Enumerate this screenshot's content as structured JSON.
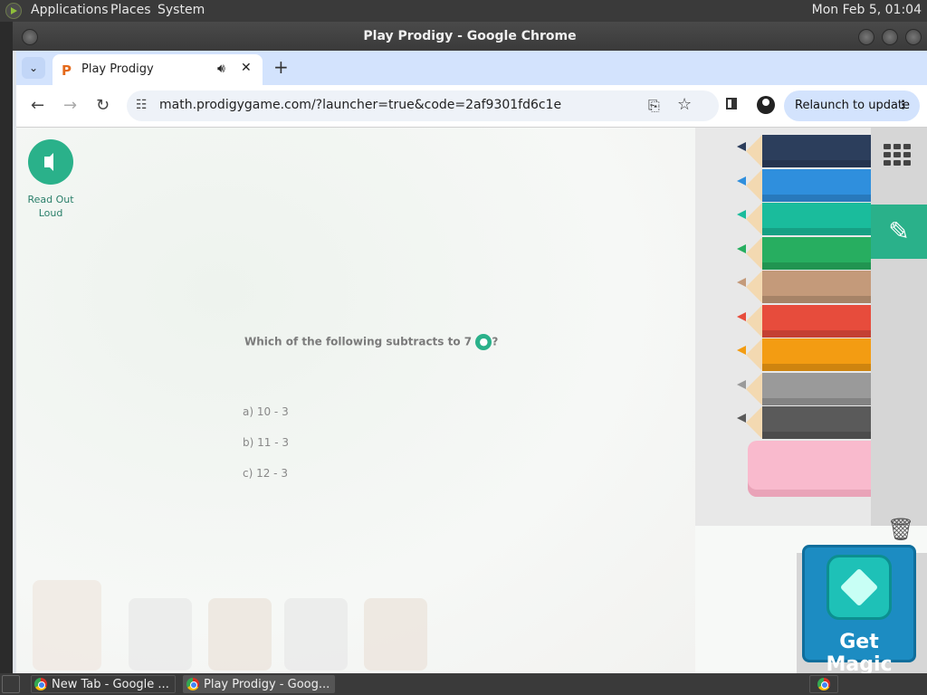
{
  "system_bar": {
    "menu": [
      "Applications",
      "Places",
      "System"
    ],
    "clock": "Mon Feb  5, 01:04"
  },
  "window": {
    "title": "Play Prodigy - Google Chrome"
  },
  "browser": {
    "tab": {
      "title": "Play Prodigy",
      "favicon": "prodigy-p-icon"
    },
    "toolbar": {
      "url": "math.prodigygame.com/?launcher=true&code=2af9301fd6c1e",
      "relaunch_label": "Relaunch to update"
    }
  },
  "page": {
    "read_out_label": "Read Out Loud",
    "question": "Which of the following subtracts to 7",
    "question_end": "?",
    "answers": [
      "a) 10 - 3",
      "b) 11 - 3",
      "c) 12 - 3"
    ],
    "magic_label": "Get Magic",
    "pencil_colors": [
      "#2c3e5c",
      "#2f8fdd",
      "#1abc9c",
      "#27ae60",
      "#c49a7a",
      "#e74c3c",
      "#f39c12",
      "#9a9a9a",
      "#5a5a5a"
    ],
    "eraser_color": "#f9bacd",
    "accent": "#2ab18a"
  },
  "taskbar": {
    "tasks": [
      "New Tab - Google ...",
      "Play Prodigy - Goog..."
    ]
  }
}
